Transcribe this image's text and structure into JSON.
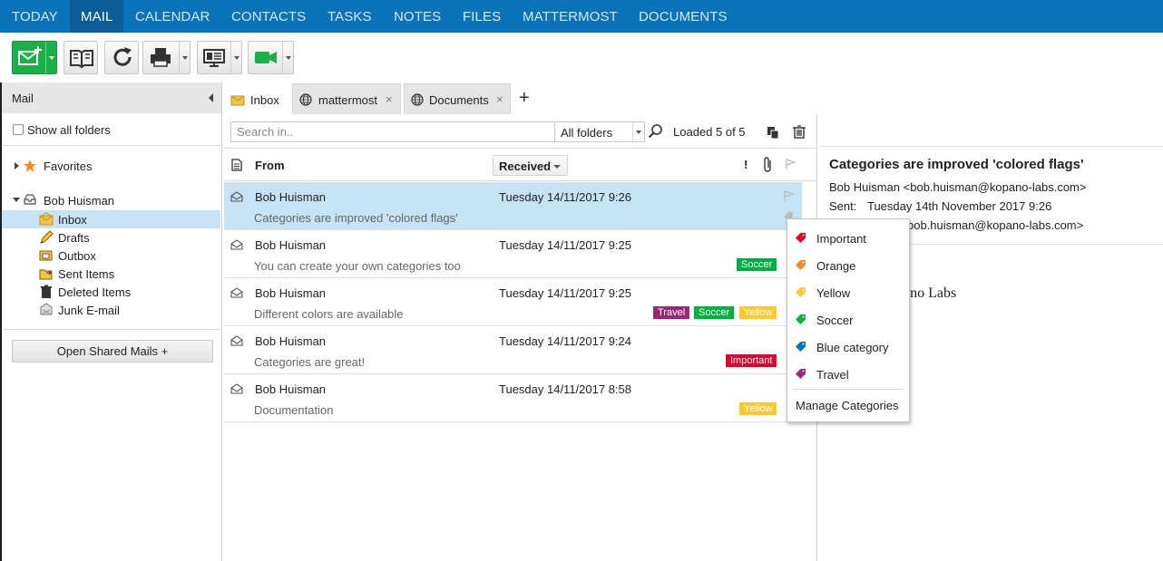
{
  "nav": {
    "tabs": [
      "TODAY",
      "MAIL",
      "CALENDAR",
      "CONTACTS",
      "TASKS",
      "NOTES",
      "FILES",
      "MATTERMOST",
      "DOCUMENTS"
    ],
    "active": "MAIL"
  },
  "toolbar": {
    "buttons": [
      "new-mail",
      "address-book",
      "refresh",
      "print",
      "presentation",
      "video-call"
    ]
  },
  "sidebar": {
    "title": "Mail",
    "show_all_label": "Show all folders",
    "favorites_label": "Favorites",
    "account": "Bob Huisman",
    "folders": [
      "Inbox",
      "Drafts",
      "Outbox",
      "Sent Items",
      "Deleted Items",
      "Junk E-mail"
    ],
    "selected_folder": "Inbox",
    "shared_button": "Open Shared Mails +"
  },
  "tabs": [
    {
      "label": "Inbox",
      "icon": "inbox-icon",
      "closable": false
    },
    {
      "label": "mattermost",
      "icon": "globe-icon",
      "closable": true
    },
    {
      "label": "Documents",
      "icon": "globe-icon",
      "closable": true
    }
  ],
  "list": {
    "search_placeholder": "Search in..",
    "folder_scope": "All folders",
    "loaded": "Loaded 5 of 5",
    "col_from": "From",
    "col_received": "Received",
    "col_importance": "!",
    "messages": [
      {
        "from": "Bob Huisman",
        "date": "Tuesday 14/11/2017 9:26",
        "subject": "Categories are improved 'colored flags'",
        "tags": [],
        "selected": true
      },
      {
        "from": "Bob Huisman",
        "date": "Tuesday 14/11/2017 9:25",
        "subject": "You can create your own categories too",
        "tags": [
          "Soccer"
        ]
      },
      {
        "from": "Bob Huisman",
        "date": "Tuesday 14/11/2017 9:25",
        "subject": "Different colors are available",
        "tags": [
          "Travel",
          "Soccer",
          "Yellow"
        ]
      },
      {
        "from": "Bob Huisman",
        "date": "Tuesday 14/11/2017 9:24",
        "subject": "Categories are great!",
        "tags": [
          "Important"
        ]
      },
      {
        "from": "Bob Huisman",
        "date": "Tuesday 14/11/2017 8:58",
        "subject": "Documentation",
        "tags": [
          "Yellow"
        ]
      }
    ]
  },
  "tag_colors": {
    "Important": "#e4002b",
    "Orange": "#f68b1f",
    "Yellow": "#fdc82f",
    "Soccer": "#00b140",
    "Blue category": "#0072ce",
    "Travel": "#9b2777"
  },
  "reading": {
    "subject": "Categories are improved 'colored flags'",
    "from": "Bob Huisman <bob.huisman@kopano-labs.com>",
    "sent_label": "Sent:",
    "sent_value": "Tuesday 14th November 2017 9:26",
    "to_partial": "sman <bob.huisman@kopano-labs.com>",
    "body_partial": "pano Labs"
  },
  "category_menu": {
    "items": [
      "Important",
      "Orange",
      "Yellow",
      "Soccer",
      "Blue category",
      "Travel"
    ],
    "manage": "Manage Categories"
  }
}
